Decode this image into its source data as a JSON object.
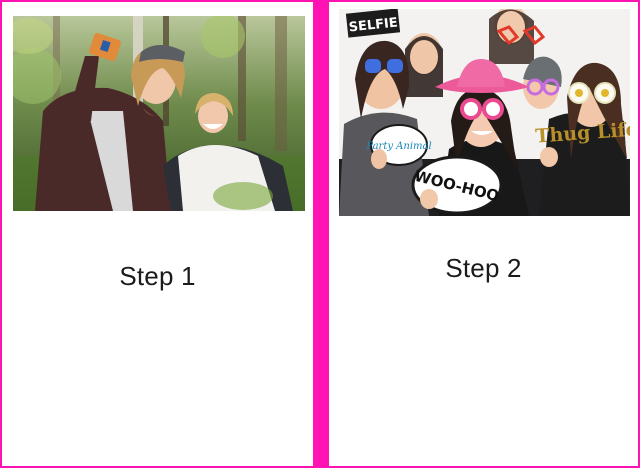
{
  "steps": [
    {
      "caption": "Step 1",
      "photo_subject": "selfie-in-forest"
    },
    {
      "caption": "Step 2",
      "photo_subject": "photo-booth-group",
      "props": {
        "selfie_sign": "SELFIE",
        "party_sign": "Party Animal",
        "woo_sign": "WOO-HOO",
        "thug_sign": "Thug Life"
      }
    }
  ]
}
